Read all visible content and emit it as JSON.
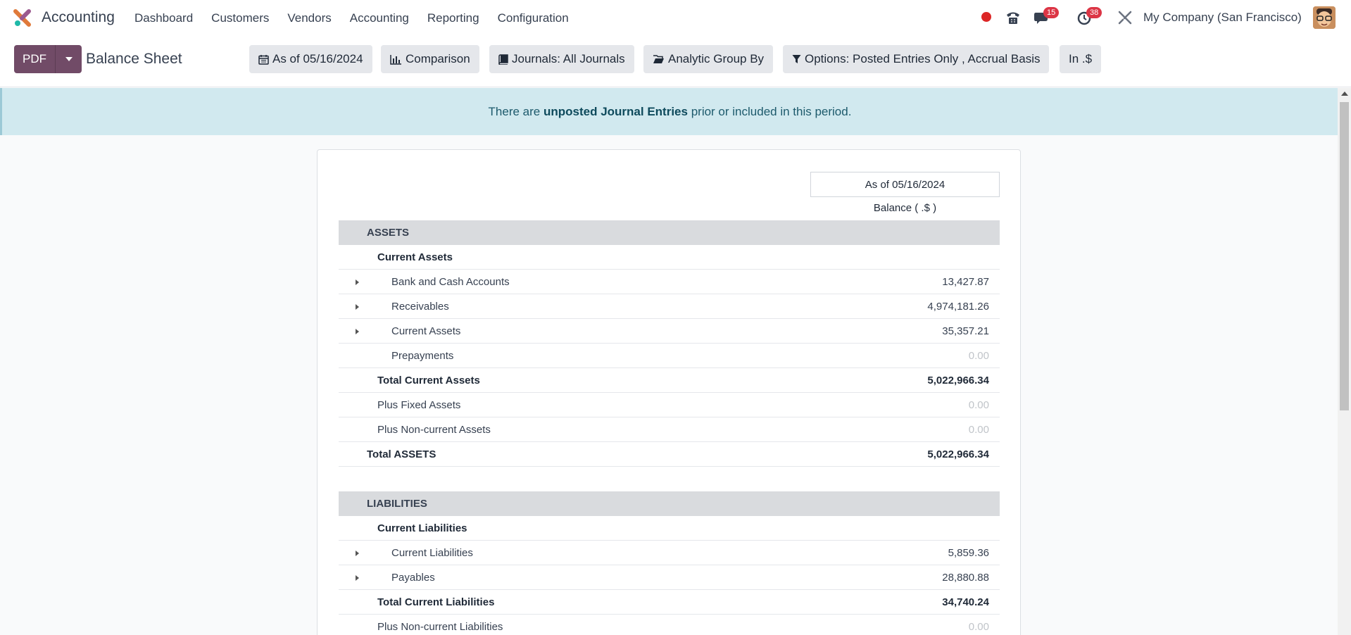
{
  "navbar": {
    "app_name": "Accounting",
    "menu": [
      "Dashboard",
      "Customers",
      "Vendors",
      "Accounting",
      "Reporting",
      "Configuration"
    ],
    "messages_badge": "15",
    "activities_badge": "38",
    "company": "My Company (San Francisco)"
  },
  "control": {
    "pdf_label": "PDF",
    "title": "Balance Sheet",
    "filters": {
      "date": "As of 05/16/2024",
      "comparison": "Comparison",
      "journals": "Journals: All Journals",
      "analytic": "Analytic Group By",
      "options": "Options: Posted Entries Only , Accrual Basis",
      "currency": "In .$"
    }
  },
  "alert": {
    "prefix": "There are",
    "link": "unposted Journal Entries",
    "suffix": "prior or included in this period."
  },
  "report": {
    "column_header": "As of 05/16/2024",
    "column_sub": "Balance ( .$ )",
    "rows": [
      {
        "label": "ASSETS",
        "value": ""
      },
      {
        "label": "Current Assets",
        "value": ""
      },
      {
        "label": "Bank and Cash Accounts",
        "value": "13,427.87"
      },
      {
        "label": "Receivables",
        "value": "4,974,181.26"
      },
      {
        "label": "Current Assets",
        "value": "35,357.21"
      },
      {
        "label": "Prepayments",
        "value": "0.00"
      },
      {
        "label": "Total Current Assets",
        "value": "5,022,966.34"
      },
      {
        "label": "Plus Fixed Assets",
        "value": "0.00"
      },
      {
        "label": "Plus Non-current Assets",
        "value": "0.00"
      },
      {
        "label": "Total ASSETS",
        "value": "5,022,966.34"
      },
      {
        "label": "",
        "value": ""
      },
      {
        "label": "LIABILITIES",
        "value": ""
      },
      {
        "label": "Current Liabilities",
        "value": ""
      },
      {
        "label": "Current Liabilities",
        "value": "5,859.36"
      },
      {
        "label": "Payables",
        "value": "28,880.88"
      },
      {
        "label": "Total Current Liabilities",
        "value": "34,740.24"
      },
      {
        "label": "Plus Non-current Liabilities",
        "value": "0.00"
      }
    ]
  },
  "colors": {
    "brand": "#714b67",
    "badge": "#dc3545",
    "alert_bg": "#d1e9ef",
    "section_bg": "#d9dbde"
  }
}
